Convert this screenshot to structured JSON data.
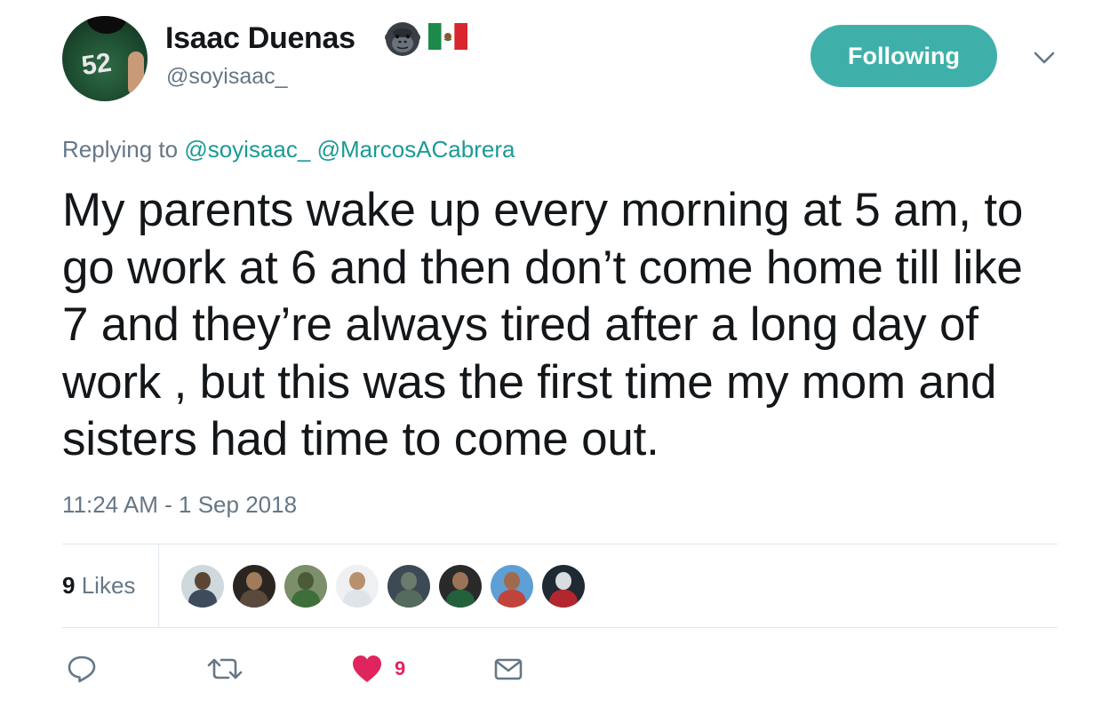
{
  "header": {
    "display_name": "Isaac Duenas",
    "handle": "@soyisaac_",
    "avatar_jersey_number": "52",
    "name_icons": [
      "gorilla-icon",
      "mexico-flag-icon"
    ],
    "follow_button_label": "Following",
    "menu_icon": "chevron-down-icon"
  },
  "reply": {
    "prefix": "Replying to",
    "mentions": [
      "@soyisaac_",
      "@MarcosACabrera"
    ]
  },
  "tweet": {
    "text": "My parents wake up every morning at 5 am, to go work at 6 and then don’t come home till like 7 and they’re always tired after a long day of work , but this was the first time my mom and sisters had time to come out.",
    "timestamp": "11:24 AM - 1 Sep 2018"
  },
  "stats": {
    "likes_number": "9",
    "likes_label": "Likes",
    "liker_avatars_count": 8
  },
  "actions": {
    "reply_icon": "reply-icon",
    "retweet_icon": "retweet-icon",
    "like_icon": "heart-icon",
    "like_count": "9",
    "dm_icon": "envelope-icon"
  },
  "colors": {
    "accent": "#3fb0a9",
    "link": "#1b9a96",
    "muted": "#657786",
    "like": "#e0245e",
    "text": "#14171a",
    "divider": "#e1e8ed"
  }
}
